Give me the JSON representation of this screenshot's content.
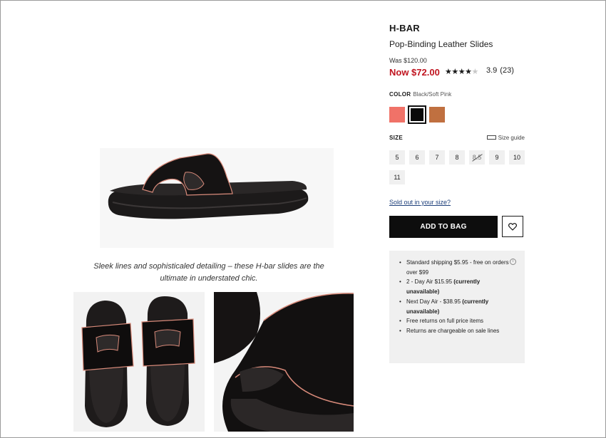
{
  "product": {
    "brand": "H-BAR",
    "name": "Pop-Binding Leather Slides",
    "was_price": "Was $120.00",
    "now_price": "Now $72.00",
    "rating": "3.9",
    "review_count": "(23)",
    "stars_filled": 4,
    "stars_total": 5
  },
  "color": {
    "label": "COLOR",
    "selected": "Black/Soft Pink",
    "swatches": [
      {
        "name": "coral",
        "hex": "#f07268"
      },
      {
        "name": "black-soft-pink",
        "hex": "#0a0a0a"
      },
      {
        "name": "tan",
        "hex": "#c07040"
      }
    ]
  },
  "size": {
    "label": "SIZE",
    "guide_label": "Size guide",
    "options": [
      "5",
      "6",
      "7",
      "8",
      "8.5",
      "9",
      "10",
      "11"
    ],
    "unavailable": [
      "8.5"
    ],
    "sold_out_link": "Sold out in your size?"
  },
  "actions": {
    "add_to_bag": "ADD TO BAG"
  },
  "shipping": {
    "items": [
      {
        "text": "Standard shipping $5.95 - free on orders over $99",
        "bold": ""
      },
      {
        "text": "2 - Day Air $15.95 ",
        "bold": "(currently unavailable)"
      },
      {
        "text": "Next Day Air -  $38.95 ",
        "bold": "(currently unavailable)"
      },
      {
        "text": "Free returns on full price items",
        "bold": ""
      },
      {
        "text": "Returns are chargeable on sale lines",
        "bold": ""
      }
    ],
    "info_icon": "i"
  },
  "gallery": {
    "caption": "Sleek lines and sophisticaled detailing – these H-bar slides are the ultimate in understated chic."
  },
  "colors": {
    "sale_red": "#c0141f",
    "button_black": "#0d0d0d",
    "panel_grey": "#f0f0f0"
  }
}
